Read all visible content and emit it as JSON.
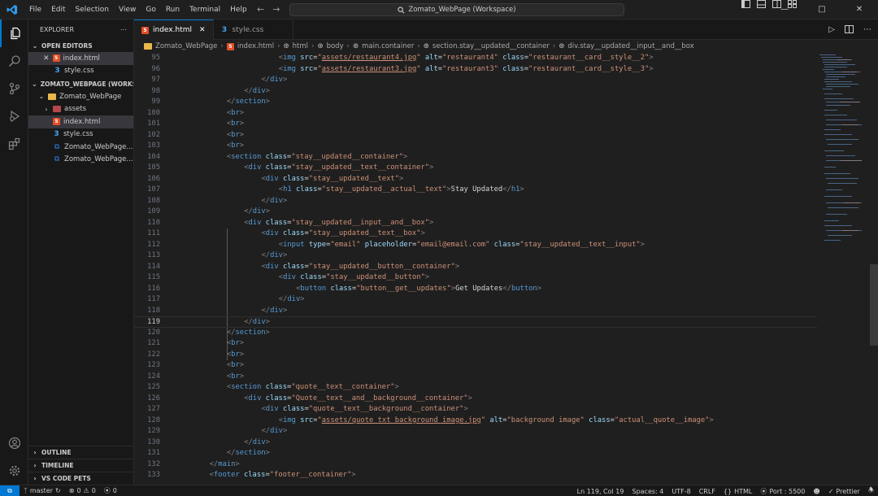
{
  "titlebar": {
    "menu": [
      "File",
      "Edit",
      "Selection",
      "View",
      "Go",
      "Run",
      "Terminal",
      "Help"
    ],
    "search": "Zomato_WebPage (Workspace)",
    "accent": "#0078d4"
  },
  "sidebar": {
    "title": "EXPLORER",
    "open_editors_label": "OPEN EDITORS",
    "open_editors": [
      {
        "name": "index.html",
        "type": "html"
      },
      {
        "name": "style.css",
        "type": "css"
      }
    ],
    "workspace_label": "ZOMATO_WEBPAGE (WORKS...",
    "folder_name": "Zomato_WebPage",
    "files": [
      {
        "name": "assets",
        "type": "folder"
      },
      {
        "name": "index.html",
        "type": "html"
      },
      {
        "name": "style.css",
        "type": "css"
      },
      {
        "name": "Zomato_WebPage...",
        "type": "workspace"
      },
      {
        "name": "Zomato_WebPage...",
        "type": "workspace"
      }
    ],
    "outline_label": "OUTLINE",
    "timeline_label": "TIMELINE",
    "vscode_pets_label": "VS CODE PETS"
  },
  "tabs": [
    {
      "name": "index.html",
      "type": "html",
      "active": true
    },
    {
      "name": "style.css",
      "type": "css",
      "active": false
    }
  ],
  "breadcrumb": [
    "Zomato_WebPage",
    "index.html",
    "html",
    "body",
    "main.container",
    "section.stay__updated__container",
    "div.stay__updated__input__and__box"
  ],
  "editor": {
    "current_line": 119,
    "lines": [
      {
        "n": 95,
        "i": 6,
        "c": "<img src=\"assets/restaurant4.jpg\" alt=\"restaurant4\" class=\"restaurant__card__style__2\">"
      },
      {
        "n": 96,
        "i": 6,
        "c": "<img src=\"assets/restaurant3.jpg\" alt=\"restaurant3\" class=\"restaurant__card__style__3\">"
      },
      {
        "n": 97,
        "i": 5,
        "c": "</div>"
      },
      {
        "n": 98,
        "i": 4,
        "c": "</div>"
      },
      {
        "n": 99,
        "i": 3,
        "c": "</section>"
      },
      {
        "n": 100,
        "i": 3,
        "c": "<br>"
      },
      {
        "n": 101,
        "i": 3,
        "c": "<br>"
      },
      {
        "n": 102,
        "i": 3,
        "c": "<br>"
      },
      {
        "n": 103,
        "i": 3,
        "c": "<br>"
      },
      {
        "n": 104,
        "i": 3,
        "c": "<section class=\"stay__updated__container\">"
      },
      {
        "n": 105,
        "i": 4,
        "c": "<div class=\"stay__updated__text__container\">"
      },
      {
        "n": 106,
        "i": 5,
        "c": "<div class=\"stay__updated__text\">"
      },
      {
        "n": 107,
        "i": 6,
        "c": "<h1 class=\"stay__updated__actual__text\">Stay Updated</h1>"
      },
      {
        "n": 108,
        "i": 5,
        "c": "</div>"
      },
      {
        "n": 109,
        "i": 4,
        "c": "</div>"
      },
      {
        "n": 110,
        "i": 4,
        "c": "<div class=\"stay__updated__input__and__box\">"
      },
      {
        "n": 111,
        "i": 5,
        "c": "<div class=\"stay__updated__text__box\">"
      },
      {
        "n": 112,
        "i": 6,
        "c": "<input type=\"email\" placeholder=\"email@email.com\" class=\"stay__updated__text__input\">"
      },
      {
        "n": 113,
        "i": 5,
        "c": "</div>"
      },
      {
        "n": 114,
        "i": 5,
        "c": "<div class=\"stay__updated__button__container\">"
      },
      {
        "n": 115,
        "i": 6,
        "c": "<div class=\"stay__updated__button\">"
      },
      {
        "n": 116,
        "i": 7,
        "c": "<button class=\"button__get__updates\">Get Updates</button>"
      },
      {
        "n": 117,
        "i": 6,
        "c": "</div>"
      },
      {
        "n": 118,
        "i": 5,
        "c": "</div>"
      },
      {
        "n": 119,
        "i": 4,
        "c": "</div>"
      },
      {
        "n": 120,
        "i": 3,
        "c": "</section>"
      },
      {
        "n": 121,
        "i": 3,
        "c": "<br>"
      },
      {
        "n": 122,
        "i": 3,
        "c": "<br>"
      },
      {
        "n": 123,
        "i": 3,
        "c": "<br>"
      },
      {
        "n": 124,
        "i": 3,
        "c": "<br>"
      },
      {
        "n": 125,
        "i": 3,
        "c": "<section class=\"quote__text__container\">"
      },
      {
        "n": 126,
        "i": 4,
        "c": "<div class=\"Quote__text__and__background__container\">"
      },
      {
        "n": 127,
        "i": 5,
        "c": "<div class=\"quote__text__background__container\">"
      },
      {
        "n": 128,
        "i": 6,
        "c": "<img src=\"assets/quote txt background image.jpg\" alt=\"background image\" class=\"actual__quote__image\">"
      },
      {
        "n": 129,
        "i": 5,
        "c": "</div>"
      },
      {
        "n": 130,
        "i": 4,
        "c": "</div>"
      },
      {
        "n": 131,
        "i": 3,
        "c": "</section>"
      },
      {
        "n": 132,
        "i": 2,
        "c": "</main>"
      },
      {
        "n": 133,
        "i": 2,
        "c": "<footer class=\"footer__container\">"
      }
    ]
  },
  "statusbar": {
    "branch": "master",
    "errors": "0",
    "warnings": "0",
    "ports": "0",
    "position": "Ln 119, Col 19",
    "spaces": "Spaces: 4",
    "encoding": "UTF-8",
    "eol": "CRLF",
    "language": "HTML",
    "port": "Port : 5500",
    "prettier": "Prettier"
  }
}
